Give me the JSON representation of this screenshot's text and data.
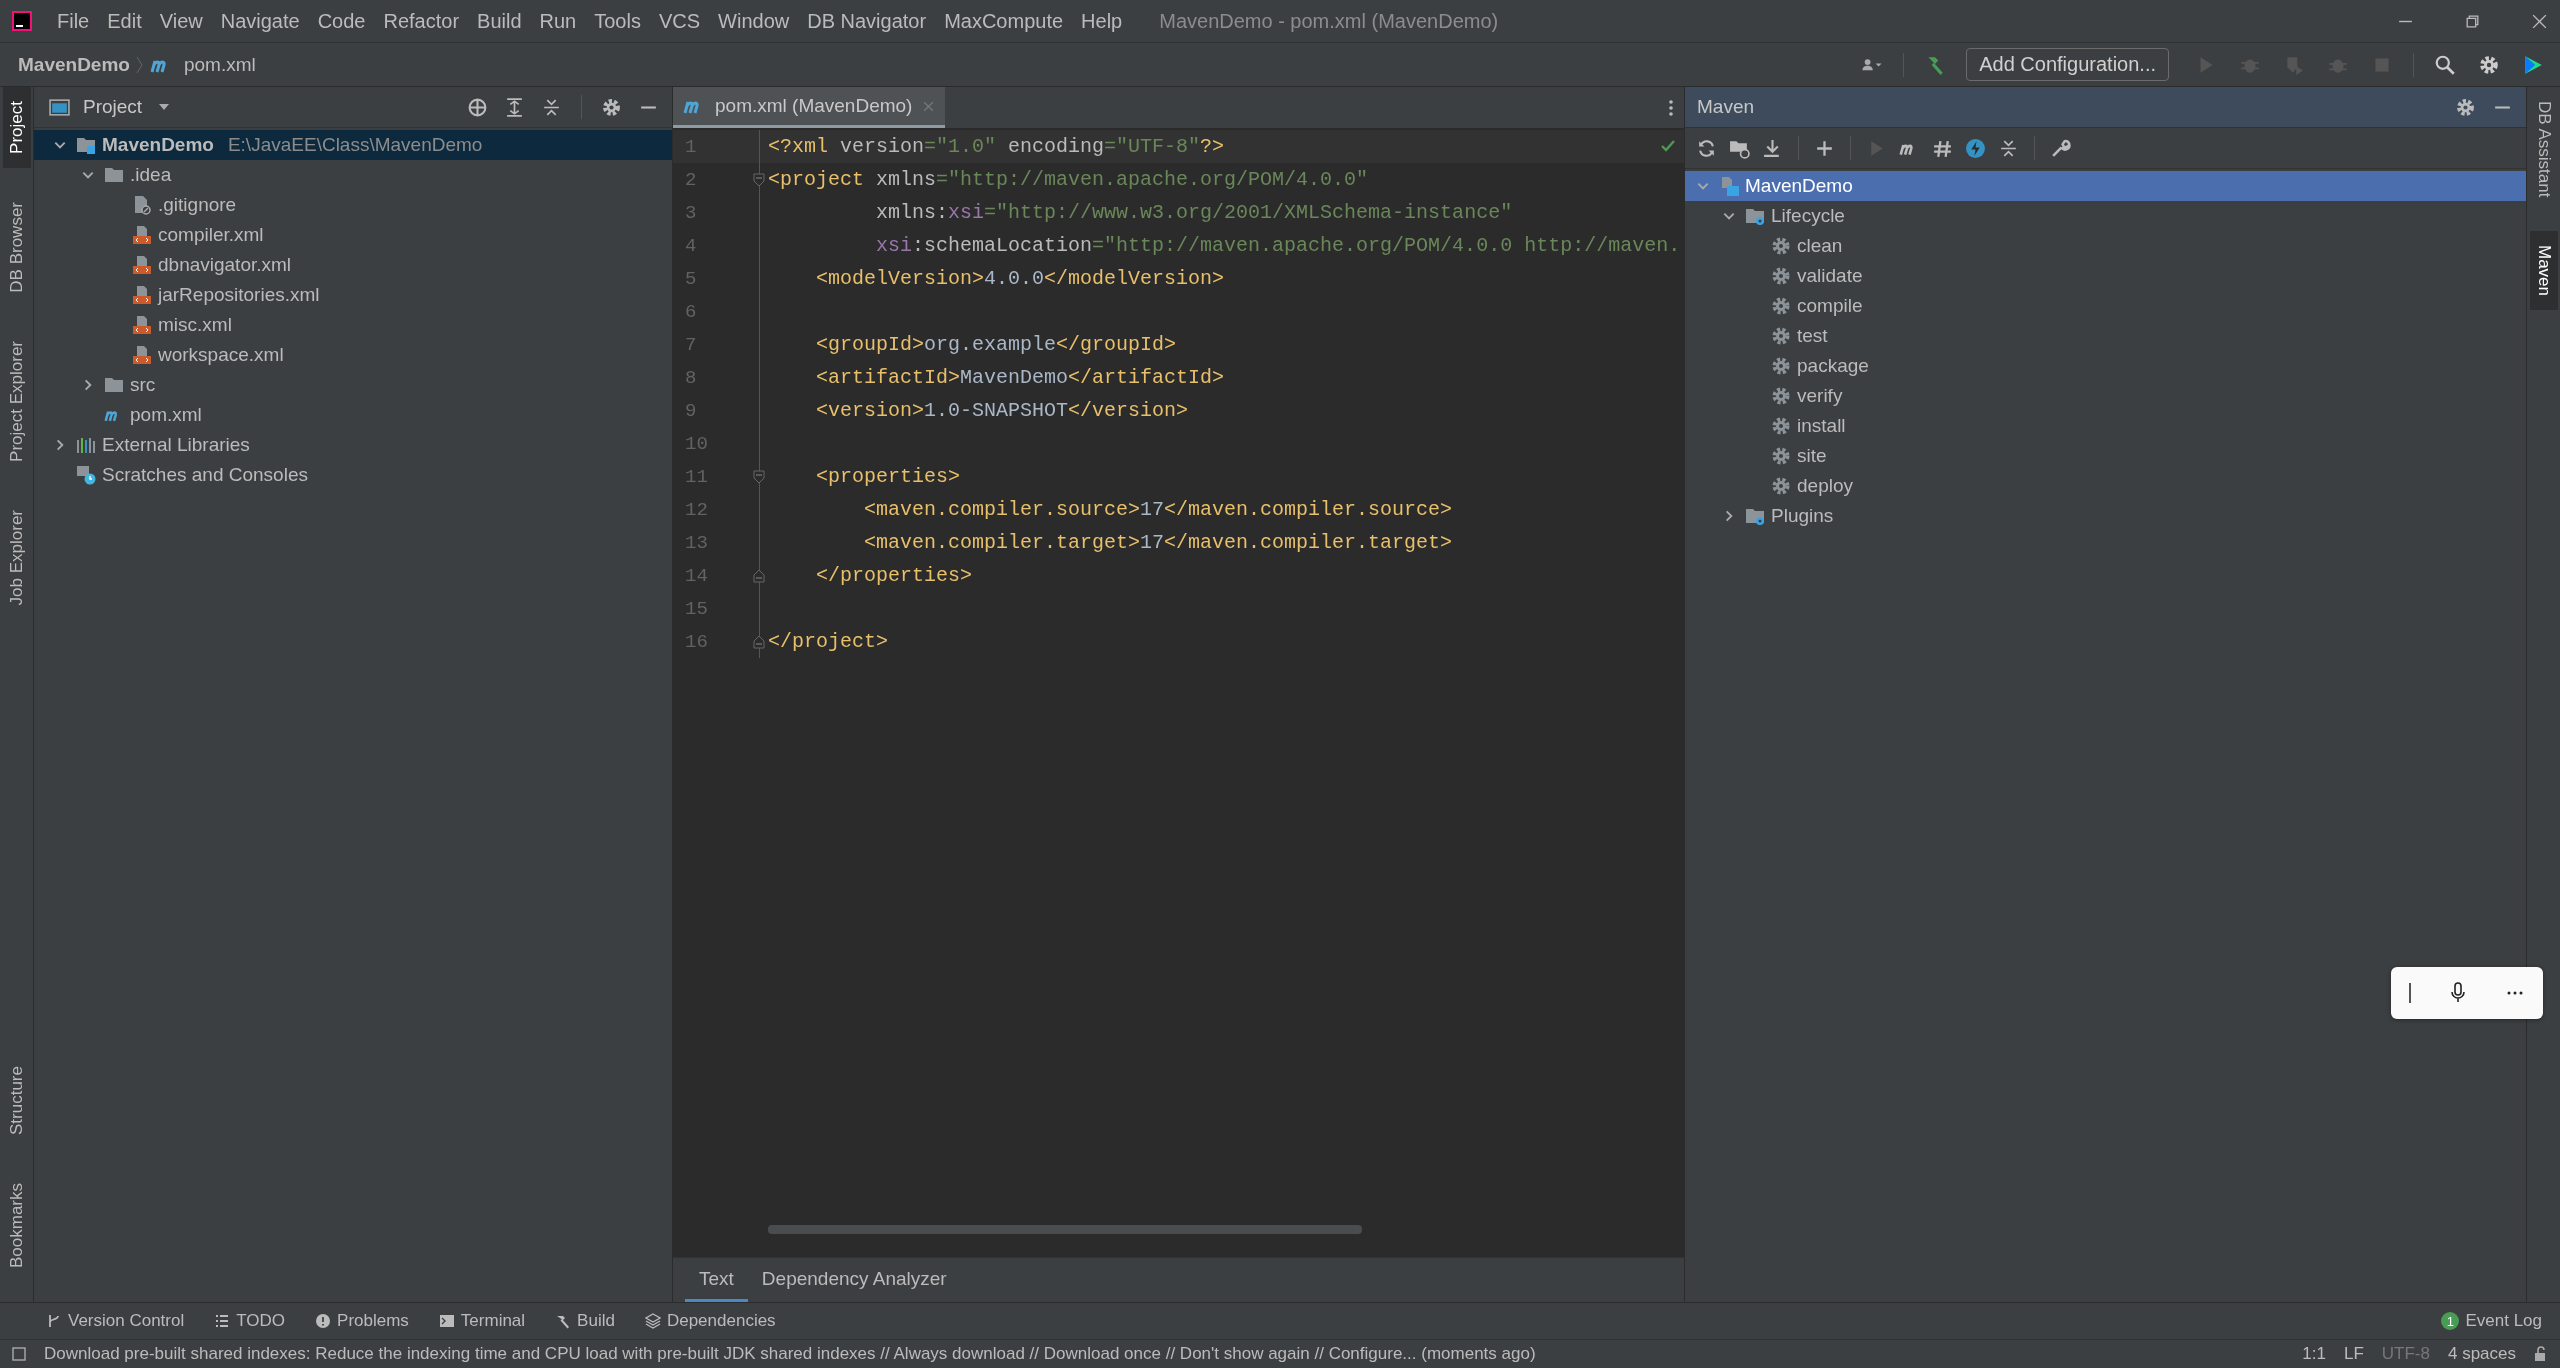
{
  "window": {
    "title": "MavenDemo - pom.xml (MavenDemo)"
  },
  "menu": [
    "File",
    "Edit",
    "View",
    "Navigate",
    "Code",
    "Refactor",
    "Build",
    "Run",
    "Tools",
    "VCS",
    "Window",
    "DB Navigator",
    "MaxCompute",
    "Help"
  ],
  "breadcrumb": [
    "MavenDemo",
    "pom.xml"
  ],
  "toolbar": {
    "run_config": "Add Configuration..."
  },
  "left_strip": [
    {
      "label": "Project",
      "selected": true
    },
    {
      "label": "DB Browser",
      "selected": false
    },
    {
      "label": "Project Explorer",
      "selected": false
    },
    {
      "label": "Job Explorer",
      "selected": false
    }
  ],
  "left_strip_bottom": [
    {
      "label": "Structure",
      "selected": false
    },
    {
      "label": "Bookmarks",
      "selected": false
    }
  ],
  "project_panel": {
    "title": "Project",
    "tree": [
      {
        "label": "MavenDemo",
        "path": "E:\\JavaEE\\Class\\MavenDemo",
        "kind": "module",
        "expanded": true,
        "selected": true,
        "children": [
          {
            "label": ".idea",
            "kind": "folder",
            "expanded": true,
            "selected": false,
            "children": [
              {
                "label": ".gitignore",
                "kind": "gitignore",
                "selected": false
              },
              {
                "label": "compiler.xml",
                "kind": "xml",
                "selected": false
              },
              {
                "label": "dbnavigator.xml",
                "kind": "xml",
                "selected": false
              },
              {
                "label": "jarRepositories.xml",
                "kind": "xml",
                "selected": false
              },
              {
                "label": "misc.xml",
                "kind": "xml",
                "selected": false
              },
              {
                "label": "workspace.xml",
                "kind": "xml",
                "selected": false
              }
            ]
          },
          {
            "label": "src",
            "kind": "folder",
            "expanded": false,
            "selected": false
          },
          {
            "label": "pom.xml",
            "kind": "maven",
            "selected": false
          }
        ]
      },
      {
        "label": "External Libraries",
        "kind": "libraries",
        "expanded": false,
        "selected": false
      },
      {
        "label": "Scratches and Consoles",
        "kind": "scratches",
        "selected": false
      }
    ]
  },
  "editor": {
    "tab": "pom.xml (MavenDemo)",
    "lines": [
      {
        "number": "1",
        "tokens": [
          {
            "kind": "tag",
            "text": "<?xml"
          },
          {
            "kind": "attr",
            "text": " version"
          },
          {
            "kind": "value",
            "text": "=\"1.0\""
          },
          {
            "kind": "attr",
            "text": " encoding"
          },
          {
            "kind": "value",
            "text": "=\"UTF-8\""
          },
          {
            "kind": "tag",
            "text": "?>"
          }
        ]
      },
      {
        "number": "2",
        "fold_start": true,
        "tokens": [
          {
            "kind": "tag",
            "text": "<project"
          },
          {
            "kind": "attr",
            "text": " xmlns"
          },
          {
            "kind": "value",
            "text": "=\"http://maven.apache.org/POM/4.0.0\""
          }
        ]
      },
      {
        "number": "3",
        "tokens": [
          {
            "kind": "attr",
            "text": "         xmlns:"
          },
          {
            "kind": "ns",
            "text": "xsi"
          },
          {
            "kind": "value",
            "text": "=\"http://www.w3.org/2001/XMLSchema-instance\""
          }
        ]
      },
      {
        "number": "4",
        "tokens": [
          {
            "kind": "ns",
            "text": "         xsi"
          },
          {
            "kind": "attr",
            "text": ":schemaLocation"
          },
          {
            "kind": "value",
            "text": "=\"http://maven.apache.org/POM/4.0.0 http://maven."
          }
        ]
      },
      {
        "number": "5",
        "tokens": [
          {
            "kind": "tag",
            "text": "    <modelVersion>"
          },
          {
            "kind": "text",
            "text": "4.0.0"
          },
          {
            "kind": "tag",
            "text": "</modelVersion>"
          }
        ]
      },
      {
        "number": "6"
      },
      {
        "number": "7",
        "tokens": [
          {
            "kind": "tag",
            "text": "    <groupId>"
          },
          {
            "kind": "text",
            "text": "org.example"
          },
          {
            "kind": "tag",
            "text": "</groupId>"
          }
        ]
      },
      {
        "number": "8",
        "tokens": [
          {
            "kind": "tag",
            "text": "    <artifactId>"
          },
          {
            "kind": "text",
            "text": "MavenDemo"
          },
          {
            "kind": "tag",
            "text": "</artifactId>"
          }
        ]
      },
      {
        "number": "9",
        "tokens": [
          {
            "kind": "tag",
            "text": "    <version>"
          },
          {
            "kind": "text",
            "text": "1.0-SNAPSHOT"
          },
          {
            "kind": "tag",
            "text": "</version>"
          }
        ]
      },
      {
        "number": "10"
      },
      {
        "number": "11",
        "fold_start": true,
        "tokens": [
          {
            "kind": "tag",
            "text": "    <properties>"
          }
        ]
      },
      {
        "number": "12",
        "tokens": [
          {
            "kind": "tag",
            "text": "        <maven.compiler.source>"
          },
          {
            "kind": "text",
            "text": "17"
          },
          {
            "kind": "tag",
            "text": "</maven.compiler.source>"
          }
        ]
      },
      {
        "number": "13",
        "tokens": [
          {
            "kind": "tag",
            "text": "        <maven.compiler.target>"
          },
          {
            "kind": "text",
            "text": "17"
          },
          {
            "kind": "tag",
            "text": "</maven.compiler.target>"
          }
        ]
      },
      {
        "number": "14",
        "fold_end": true,
        "tokens": [
          {
            "kind": "tag",
            "text": "    </properties>"
          }
        ]
      },
      {
        "number": "15"
      },
      {
        "number": "16",
        "fold_end": true,
        "tokens": [
          {
            "kind": "tag",
            "text": "</project>"
          }
        ]
      }
    ],
    "bottom_tabs": [
      {
        "label": "Text",
        "selected": true
      },
      {
        "label": "Dependency Analyzer",
        "selected": false
      }
    ]
  },
  "maven_panel": {
    "title": "Maven",
    "tree": [
      {
        "label": "MavenDemo",
        "kind": "project",
        "expanded": true,
        "selected": true,
        "children": [
          {
            "label": "Lifecycle",
            "kind": "lifecycle",
            "expanded": true,
            "selected": false,
            "children": [
              {
                "label": "clean",
                "kind": "goal",
                "selected": false
              },
              {
                "label": "validate",
                "kind": "goal",
                "selected": false
              },
              {
                "label": "compile",
                "kind": "goal",
                "selected": false
              },
              {
                "label": "test",
                "kind": "goal",
                "selected": false
              },
              {
                "label": "package",
                "kind": "goal",
                "selected": false
              },
              {
                "label": "verify",
                "kind": "goal",
                "selected": false
              },
              {
                "label": "install",
                "kind": "goal",
                "selected": false
              },
              {
                "label": "site",
                "kind": "goal",
                "selected": false
              },
              {
                "label": "deploy",
                "kind": "goal",
                "selected": false
              }
            ]
          },
          {
            "label": "Plugins",
            "kind": "lifecycle",
            "expanded": false,
            "selected": false
          }
        ]
      }
    ]
  },
  "right_strip": [
    {
      "label": "DB Assistant",
      "selected": false
    },
    {
      "label": "Maven",
      "selected": true
    }
  ],
  "tool_windows": [
    {
      "label": "Version Control",
      "kind": "vcs"
    },
    {
      "label": "TODO",
      "kind": "todo"
    },
    {
      "label": "Problems",
      "kind": "problems"
    },
    {
      "label": "Terminal",
      "kind": "terminal"
    },
    {
      "label": "Build",
      "kind": "build"
    },
    {
      "label": "Dependencies",
      "kind": "dependencies"
    }
  ],
  "event_log": {
    "label": "Event Log",
    "count": "1"
  },
  "status_bar": {
    "message": "Download pre-built shared indexes: Reduce the indexing time and CPU load with pre-built JDK shared indexes // Always download // Download once // Don't show again // Configure... (moments ago)",
    "position": "1:1",
    "line_separator": "LF",
    "encoding": "UTF-8",
    "indent": "4 spaces"
  }
}
